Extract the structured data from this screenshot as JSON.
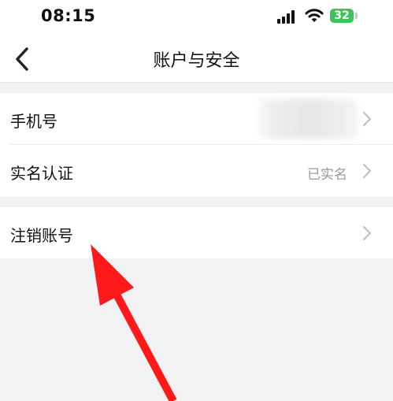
{
  "status_bar": {
    "time": "08:15",
    "battery": "32"
  },
  "nav": {
    "title": "账户与安全"
  },
  "settings": {
    "rows": [
      {
        "label": "手机号",
        "value": ""
      },
      {
        "label": "实名认证",
        "value": "已实名"
      },
      {
        "label": "注销账号",
        "value": ""
      }
    ]
  },
  "colors": {
    "battery": "#3cc45b",
    "annotation_arrow": "#ff1a1a",
    "background": "#f2f2f4"
  },
  "icons": [
    "signal-icon",
    "wifi-icon",
    "back-chevron-icon",
    "chevron-right-icon"
  ]
}
